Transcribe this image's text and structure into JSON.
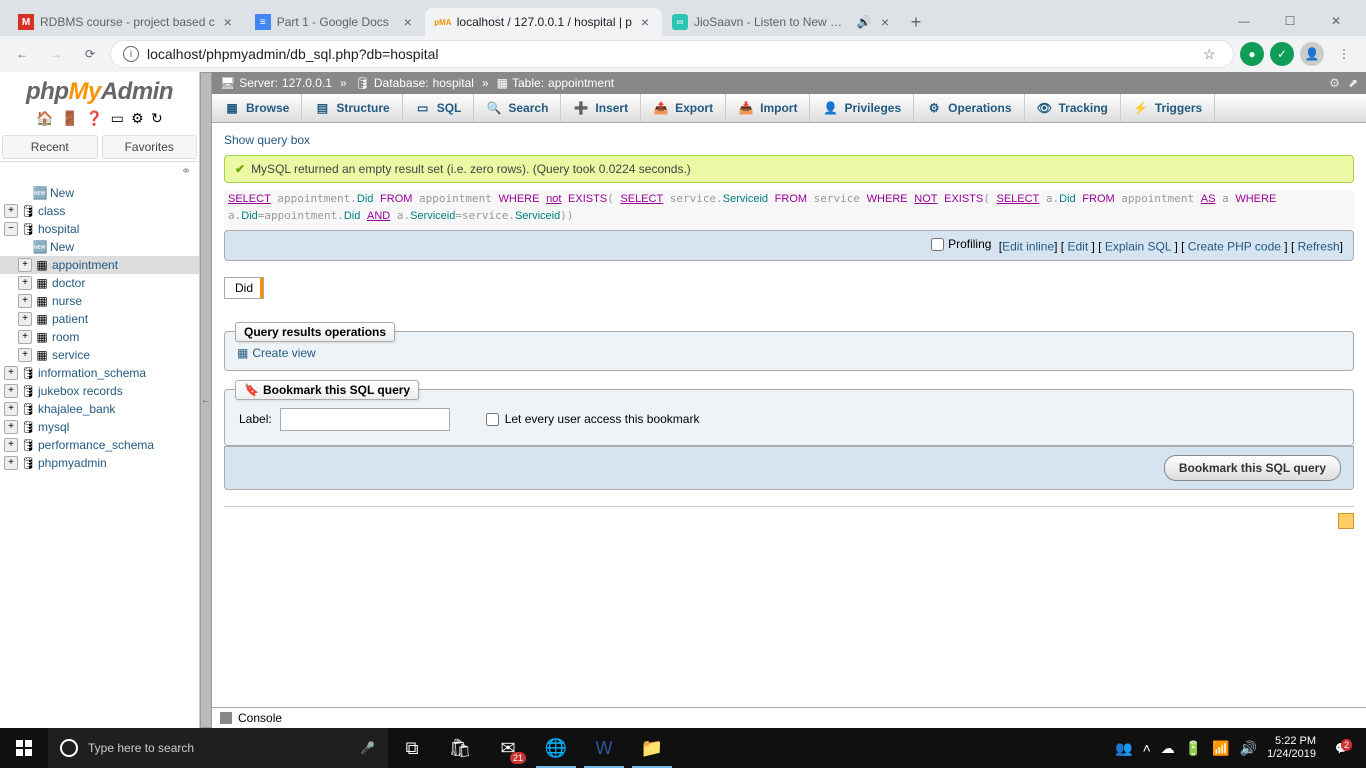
{
  "browser": {
    "tabs": [
      {
        "title": "RDBMS course - project based c",
        "icon": "M",
        "iconColor": "#d93025"
      },
      {
        "title": "Part 1 - Google Docs",
        "icon": "📄",
        "iconColor": "#4285f4"
      },
      {
        "title": "localhost / 127.0.0.1 / hospital | p",
        "icon": "pma",
        "active": true
      },
      {
        "title": "JioSaavn - Listen to New & G",
        "icon": "∞",
        "iconColor": "#2bc5b4",
        "sound": true
      }
    ],
    "url": "localhost/phpmyadmin/db_sql.php?db=hospital"
  },
  "breadcrumb": {
    "server_label": "Server:",
    "server_value": "127.0.0.1",
    "db_label": "Database:",
    "db_value": "hospital",
    "table_label": "Table:",
    "table_value": "appointment"
  },
  "topmenu": [
    "Browse",
    "Structure",
    "SQL",
    "Search",
    "Insert",
    "Export",
    "Import",
    "Privileges",
    "Operations",
    "Tracking",
    "Triggers"
  ],
  "topmenu_icons": [
    "▦",
    "▤",
    "▭",
    "🔍",
    "➕",
    "📤",
    "📥",
    "👤",
    "⚙",
    "👁",
    "⚡"
  ],
  "sidebar": {
    "recent": "Recent",
    "favorites": "Favorites",
    "new": "New",
    "databases": [
      {
        "name": "class",
        "expand": "+"
      },
      {
        "name": "hospital",
        "expand": "−",
        "tables": [
          {
            "name": "appointment",
            "selected": true
          },
          {
            "name": "doctor"
          },
          {
            "name": "nurse"
          },
          {
            "name": "patient"
          },
          {
            "name": "room"
          },
          {
            "name": "service"
          }
        ]
      },
      {
        "name": "information_schema",
        "expand": "+"
      },
      {
        "name": "jukebox records",
        "expand": "+"
      },
      {
        "name": "khajalee_bank",
        "expand": "+"
      },
      {
        "name": "mysql",
        "expand": "+"
      },
      {
        "name": "performance_schema",
        "expand": "+"
      },
      {
        "name": "phpmyadmin",
        "expand": "+"
      }
    ]
  },
  "content": {
    "show_query_box": "Show query box",
    "success_msg": "MySQL returned an empty result set (i.e. zero rows). (Query took 0.0224 seconds.)",
    "profiling": "Profiling",
    "edit_inline": "Edit inline",
    "edit": "Edit",
    "explain": "Explain SQL",
    "create_php": "Create PHP code",
    "refresh": "Refresh",
    "column_header": "Did",
    "qro_legend": "Query results operations",
    "create_view": "Create view",
    "bookmark_legend": "Bookmark this SQL query",
    "label": "Label:",
    "let_every_user": "Let every user access this bookmark",
    "bookmark_btn": "Bookmark this SQL query",
    "console": "Console"
  },
  "taskbar": {
    "search_placeholder": "Type here to search",
    "time": "5:22 PM",
    "date": "1/24/2019",
    "mail_badge": "21",
    "notif_badge": "2"
  }
}
